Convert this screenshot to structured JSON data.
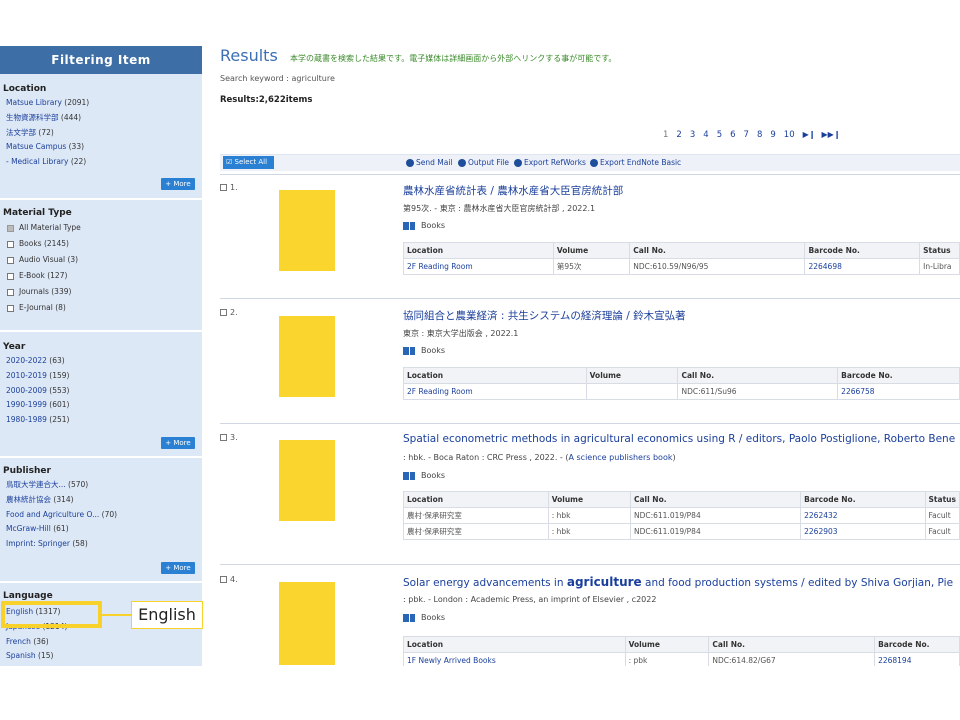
{
  "sidebar": {
    "title": "Filtering Item",
    "location": {
      "title": "Location",
      "items": [
        {
          "label": "Matsue Library",
          "count": "(2091)"
        },
        {
          "label": "生物資源科学部",
          "count": "(444)"
        },
        {
          "label": "法文学部",
          "count": "(72)"
        },
        {
          "label": "Matsue Campus",
          "count": "(33)"
        },
        {
          "label": "- Medical Library",
          "count": "(22)"
        }
      ],
      "more": "+ More"
    },
    "material_type": {
      "title": "Material Type",
      "items": [
        {
          "label": "All Material Type",
          "count": "",
          "checked": true
        },
        {
          "label": "Books",
          "count": "(2145)"
        },
        {
          "label": "Audio Visual",
          "count": "(3)"
        },
        {
          "label": "E-Book",
          "count": "(127)"
        },
        {
          "label": "Journals",
          "count": "(339)"
        },
        {
          "label": "E-Journal",
          "count": "(8)"
        }
      ]
    },
    "year": {
      "title": "Year",
      "items": [
        {
          "label": "2020-2022",
          "count": "(63)"
        },
        {
          "label": "2010-2019",
          "count": "(159)"
        },
        {
          "label": "2000-2009",
          "count": "(553)"
        },
        {
          "label": "1990-1999",
          "count": "(601)"
        },
        {
          "label": "1980-1989",
          "count": "(251)"
        }
      ],
      "more": "+ More"
    },
    "publisher": {
      "title": "Publisher",
      "items": [
        {
          "label": "鳥取大学連合大...",
          "count": "(570)"
        },
        {
          "label": "農林統計協会",
          "count": "(314)"
        },
        {
          "label": "Food and Agriculture O...",
          "count": "(70)"
        },
        {
          "label": "McGraw-Hill",
          "count": "(61)"
        },
        {
          "label": "Imprint: Springer",
          "count": "(58)"
        }
      ],
      "more": "+ More"
    },
    "language": {
      "title": "Language",
      "items": [
        {
          "label": "English",
          "count": "(1317)"
        },
        {
          "label": "Japanese",
          "count": "(1214)"
        },
        {
          "label": "French",
          "count": "(36)"
        },
        {
          "label": "Spanish",
          "count": "(15)"
        }
      ]
    }
  },
  "callout": {
    "label": "English",
    "color": "#f9d12b"
  },
  "main": {
    "title": "Results",
    "note": "本学の蔵書を検索した結果です。電子媒体は詳細画面から外部へリンクする事が可能です。",
    "search_keyword": "Search keyword : agriculture",
    "results_count": "Results:2,622items",
    "pager": [
      "1",
      "2",
      "3",
      "4",
      "5",
      "6",
      "7",
      "8",
      "9",
      "10"
    ],
    "pager_next": "⏭",
    "pager_last": "⏭⏭"
  },
  "toolbar": {
    "select_all": "Select All",
    "send_mail": "Send Mail",
    "output_file": "Output File",
    "export_refworks": "Export RefWorks",
    "export_endnote": "Export EndNote Basic"
  },
  "results": [
    {
      "num": "1.",
      "title": "農林水産省統計表 / 農林水産省大臣官房統計部",
      "pub": "第95次. - 東京 : 農林水産省大臣官房統計部 , 2022.1",
      "type": "Books",
      "headers": [
        "Location",
        "Volume",
        "Call No.",
        "Barcode No.",
        "Status"
      ],
      "rows": [
        [
          "2F Reading Room",
          "第95次",
          "NDC:610.59/N96/95",
          "2264698",
          "In-Libra"
        ]
      ]
    },
    {
      "num": "2.",
      "title": "協同組合と農業経済 : 共生システムの経済理論 / 鈴木宣弘著",
      "pub": "東京 : 東京大学出版会 , 2022.1",
      "type": "Books",
      "headers": [
        "Location",
        "Volume",
        "Call No.",
        "Barcode No."
      ],
      "rows": [
        [
          "2F Reading Room",
          "",
          "NDC:611/Su96",
          "2266758"
        ]
      ]
    },
    {
      "num": "3.",
      "title": "Spatial econometric methods in agricultural economics using R / editors, Paolo Postiglione, Roberto Bene",
      "pub_prefix": ": hbk. - Boca Raton : CRC Press , 2022. - (",
      "pub_link": "A science publishers book",
      "pub_suffix": ")",
      "type": "Books",
      "headers": [
        "Location",
        "Volume",
        "Call No.",
        "Barcode No.",
        "Status"
      ],
      "rows": [
        [
          "農村·保承研究室",
          ": hbk",
          "NDC:611.019/P84",
          "2262432",
          "Facult"
        ],
        [
          "農村·保承研究室",
          ": hbk",
          "NDC:611.019/P84",
          "2262903",
          "Facult"
        ]
      ]
    },
    {
      "num": "4.",
      "title_before": "Solar energy advancements in ",
      "title_highlight": "agriculture",
      "title_after": " and food production systems / edited by Shiva Gorjian, Pie",
      "pub": ": pbk. - London : Academic Press, an imprint of Elsevier , c2022",
      "type": "Books",
      "headers": [
        "Location",
        "Volume",
        "Call No.",
        "Barcode No."
      ],
      "rows": [
        [
          "1F Newly Arrived Books",
          ": pbk",
          "NDC:614.82/G67",
          "2268194"
        ]
      ]
    }
  ]
}
